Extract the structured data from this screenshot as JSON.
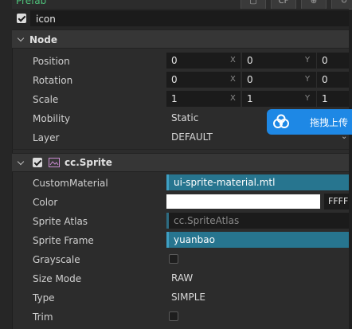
{
  "top": {
    "prefab_label": "Prefab",
    "toolbar_icons": [
      "page-icon",
      "cc-icon",
      "target-icon",
      "refresh-icon"
    ],
    "toolbar_cc_text": "CF"
  },
  "node_name": {
    "value": "icon",
    "active": true
  },
  "node_section": {
    "title": "Node",
    "position": {
      "label": "Position",
      "x": "0",
      "y": "0",
      "z": "0"
    },
    "rotation": {
      "label": "Rotation",
      "x": "0",
      "y": "0",
      "z": "0"
    },
    "scale": {
      "label": "Scale",
      "x": "1",
      "y": "1",
      "z": "1"
    },
    "mobility": {
      "label": "Mobility",
      "value": "Static"
    },
    "layer": {
      "label": "Layer",
      "value": "DEFAULT"
    },
    "axis_x": "X",
    "axis_y": "Y"
  },
  "sprite_section": {
    "title": "cc.Sprite",
    "enabled": true,
    "custom_material": {
      "label": "CustomMaterial",
      "value": "ui-sprite-material.mtl"
    },
    "color": {
      "label": "Color",
      "swatch": "#ffffff",
      "hex_text": "FFFF"
    },
    "sprite_atlas": {
      "label": "Sprite Atlas",
      "placeholder": "cc.SpriteAtlas"
    },
    "sprite_frame": {
      "label": "Sprite Frame",
      "value": "yuanbao"
    },
    "grayscale": {
      "label": "Grayscale",
      "checked": false
    },
    "size_mode": {
      "label": "Size Mode",
      "value": "RAW"
    },
    "type": {
      "label": "Type",
      "value": "SIMPLE"
    },
    "trim": {
      "label": "Trim",
      "checked": false
    }
  },
  "floating_widget": {
    "text": "拖拽上传"
  },
  "colors": {
    "accent": "#27758f",
    "prefab_green": "#4ec27b",
    "float_blue": "#1e88e5"
  }
}
